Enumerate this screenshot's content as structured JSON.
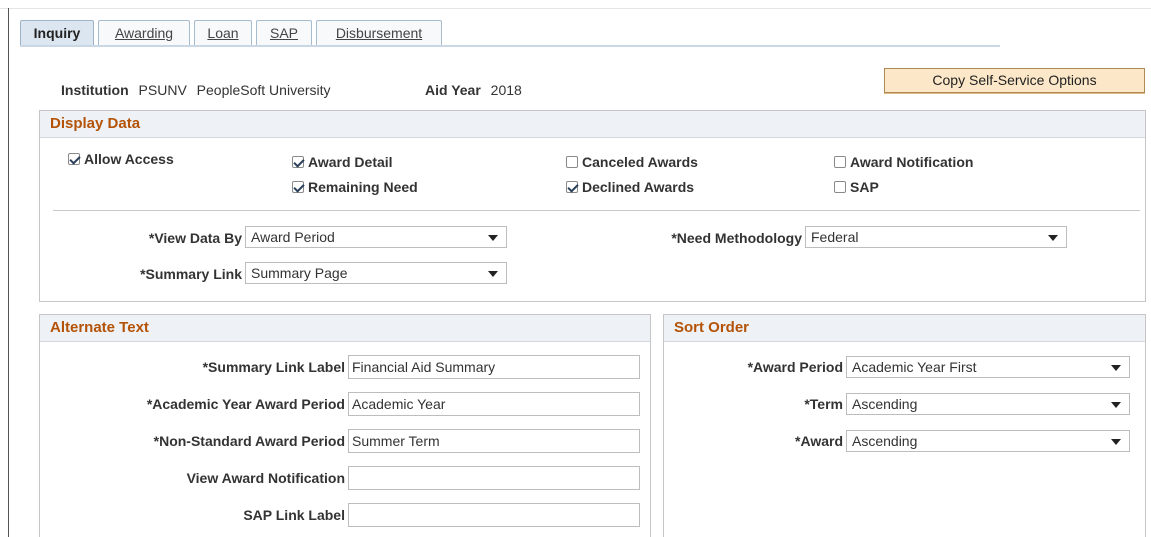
{
  "tabs": [
    {
      "label": "Inquiry",
      "active": true
    },
    {
      "label": "Awarding",
      "active": false
    },
    {
      "label": "Loan",
      "active": false
    },
    {
      "label": "SAP",
      "active": false
    },
    {
      "label": "Disbursement",
      "active": false
    }
  ],
  "header": {
    "institution_label": "Institution",
    "institution_code": "PSUNV",
    "institution_name": "PeopleSoft University",
    "aid_year_label": "Aid Year",
    "aid_year_value": "2018",
    "copy_button_label": "Copy Self-Service Options"
  },
  "display_data": {
    "title": "Display Data",
    "checkboxes": {
      "allow_access": {
        "label": "Allow Access",
        "checked": true
      },
      "award_detail": {
        "label": "Award Detail",
        "checked": true
      },
      "remaining_need": {
        "label": "Remaining Need",
        "checked": true
      },
      "canceled_awards": {
        "label": "Canceled Awards",
        "checked": false
      },
      "declined_awards": {
        "label": "Declined Awards",
        "checked": true
      },
      "award_notification": {
        "label": "Award Notification",
        "checked": false
      },
      "sap": {
        "label": "SAP",
        "checked": false
      }
    },
    "view_data_by": {
      "label": "*View Data By",
      "value": "Award Period"
    },
    "summary_link": {
      "label": "*Summary Link",
      "value": "Summary Page"
    },
    "need_methodology": {
      "label": "*Need Methodology",
      "value": "Federal"
    }
  },
  "alternate_text": {
    "title": "Alternate Text",
    "fields": {
      "summary_link_label": {
        "label": "*Summary Link Label",
        "value": "Financial Aid Summary"
      },
      "academic_year_award_period": {
        "label": "*Academic Year Award Period",
        "value": "Academic Year"
      },
      "non_standard_award_period": {
        "label": "*Non-Standard Award Period",
        "value": "Summer Term"
      },
      "view_award_notification": {
        "label": "View Award Notification",
        "value": ""
      },
      "sap_link_label": {
        "label": "SAP Link Label",
        "value": ""
      }
    }
  },
  "sort_order": {
    "title": "Sort Order",
    "award_period": {
      "label": "*Award Period",
      "value": "Academic Year First"
    },
    "term": {
      "label": "*Term",
      "value": "Ascending"
    },
    "award": {
      "label": "*Award",
      "value": "Ascending"
    }
  },
  "icons": {
    "checkbox": "checkbox-icon",
    "dropdown": "chevron-down-icon"
  }
}
